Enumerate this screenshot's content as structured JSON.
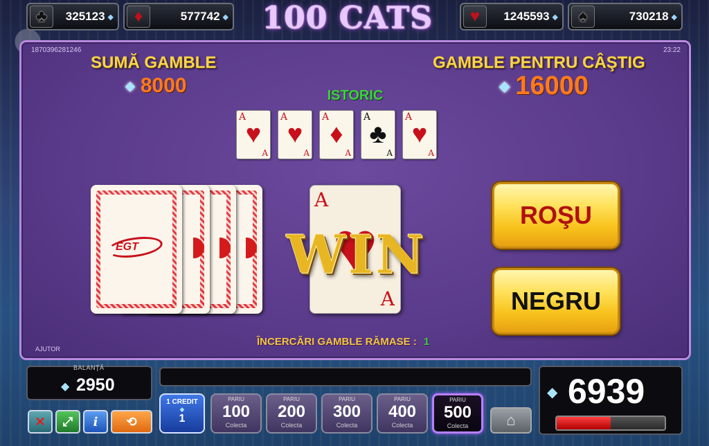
{
  "jackpots": [
    {
      "suit": "club-icon",
      "glyph": "♣",
      "value": "325123"
    },
    {
      "suit": "diamond-icon",
      "glyph": "♦",
      "value": "577742"
    },
    {
      "suit": "heart-icon",
      "glyph": "♥",
      "value": "1245593"
    },
    {
      "suit": "spade-icon",
      "glyph": "♠",
      "value": "730218"
    }
  ],
  "logo": "100 CATS",
  "game_id": "1870396281246",
  "clock": "23:22",
  "gamble_amount": {
    "label": "SUMĂ GAMBLE",
    "value": "8000"
  },
  "gamble_to_win": {
    "label": "GAMBLE PENTRU CÂŞTIG",
    "value": "16000"
  },
  "history": {
    "label": "ISTORIC",
    "cards": [
      {
        "rank": "A",
        "suit": "♥",
        "color": "#c8101a"
      },
      {
        "rank": "A",
        "suit": "♥",
        "color": "#c8101a"
      },
      {
        "rank": "A",
        "suit": "♦",
        "color": "#c8101a"
      },
      {
        "rank": "A",
        "suit": "♣",
        "color": "#111111"
      },
      {
        "rank": "A",
        "suit": "♥",
        "color": "#c8101a"
      }
    ]
  },
  "deck_logo": "EGT",
  "drawn_card": {
    "rank": "A",
    "suit": "♥"
  },
  "win_text": "WIN",
  "buttons": {
    "red": "ROŞU",
    "black": "NEGRU"
  },
  "tries": {
    "label": "ÎNCERCĂRI GAMBLE RĂMASE :",
    "count": "1"
  },
  "help": "AJUTOR",
  "balance": {
    "label": "BALANŢĂ",
    "value": "2950"
  },
  "credit": {
    "label": "1 CREDIT",
    "value": "1"
  },
  "bets": [
    {
      "top": "PARIU",
      "value": "100",
      "bottom": "Colecta",
      "active": false
    },
    {
      "top": "PARIU",
      "value": "200",
      "bottom": "Colecta",
      "active": false
    },
    {
      "top": "PARIU",
      "value": "300",
      "bottom": "Colecta",
      "active": false
    },
    {
      "top": "PARIU",
      "value": "400",
      "bottom": "Colecta",
      "active": false
    },
    {
      "top": "PARIU",
      "value": "500",
      "bottom": "Colecta",
      "active": true
    }
  ],
  "win_total": "6939",
  "win_progress": 0.5,
  "colors": {
    "panel": "#5a3a8a",
    "gold": "#f7d44a",
    "amount": "#ff7a1c",
    "green": "#3fcf3f"
  }
}
